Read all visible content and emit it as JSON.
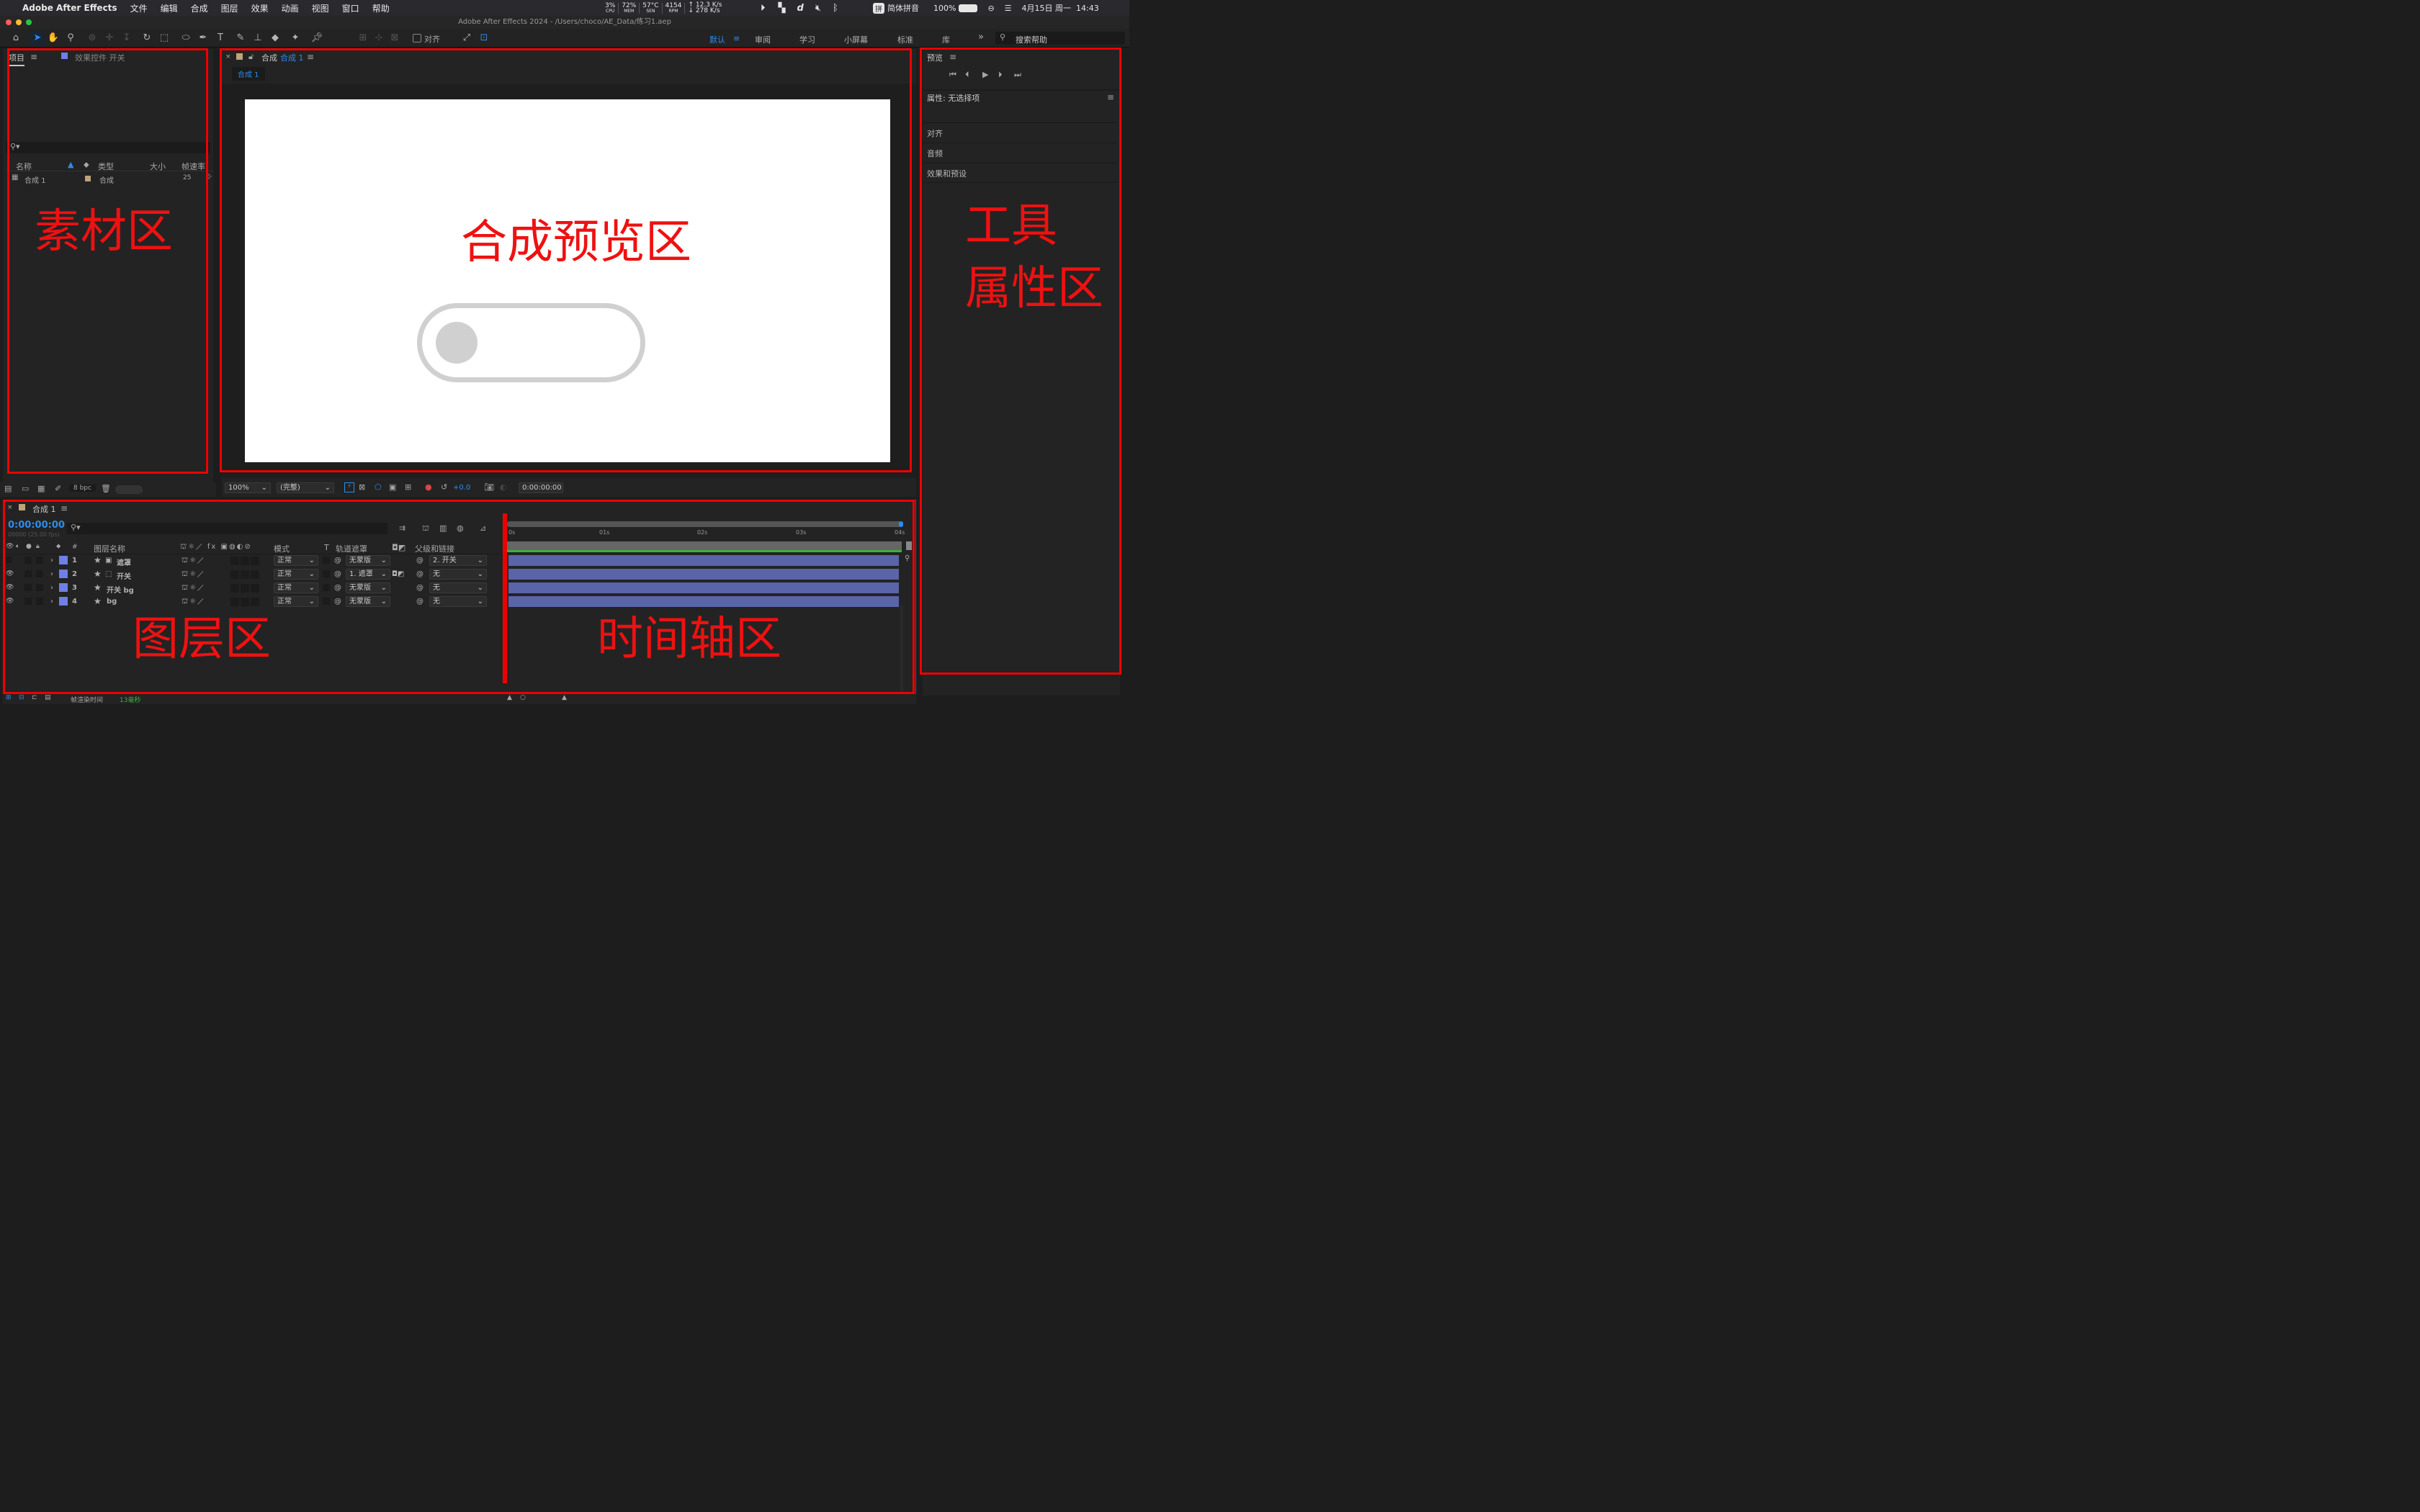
{
  "menubar": {
    "apple": "",
    "app": "Adobe After Effects",
    "items": [
      "文件",
      "编辑",
      "合成",
      "图层",
      "效果",
      "动画",
      "视图",
      "窗口",
      "帮助"
    ],
    "cpu": "3%",
    "cpu_l": "CPU",
    "mem": "72%",
    "mem_l": "MEM",
    "sen": "57°C",
    "sen_l": "SEN",
    "rpm": "4154",
    "rpm_l": "RPM",
    "up": "↑ 12.3 K/s",
    "down": "↓ 278 K/s",
    "ime": "简体拼音",
    "ime_badge": "拼",
    "battery": "100%",
    "datetime": "4月15日 周一  14:43"
  },
  "title": "Adobe After Effects 2024 - /Users/choco/AE_Data/练习1.aep",
  "toolbar": {
    "align_label": "对齐",
    "workspaces": [
      "默认",
      "审阅",
      "学习",
      "小屏幕",
      "标准",
      "库"
    ],
    "search_placeholder": "搜索帮助",
    "more": "»"
  },
  "project": {
    "tab": "项目",
    "tab2": "效果控件 开关",
    "columns": [
      "名称",
      "类型",
      "大小",
      "帧速率"
    ],
    "items": [
      {
        "name": "合成 1",
        "type": "合成",
        "rate": "25"
      }
    ],
    "bpc": "8 bpc"
  },
  "comp": {
    "tab_prefix": "合成",
    "tab_name": "合成 1",
    "subtab": "合成 1",
    "zoom": "100%",
    "quality": "(完整)",
    "exposure": "+0.0",
    "timecode": "0:00:00:00"
  },
  "timeline": {
    "tab": "合成 1",
    "timecode": "0:00:00:00",
    "fps": "00000 (25.00 fps)",
    "col_name": "图层名称",
    "col_mode": "模式",
    "col_t": "T",
    "col_track": "轨道遮罩",
    "col_parent": "父级和链接",
    "col_num": "#",
    "layers": [
      {
        "num": "1",
        "name": "遮罩",
        "mode": "正常",
        "track": "无蒙版",
        "parent": "2. 开关"
      },
      {
        "num": "2",
        "name": "开关",
        "mode": "正常",
        "track": "1. 遮罩",
        "parent": "无"
      },
      {
        "num": "3",
        "name": "开关 bg",
        "mode": "正常",
        "track": "无蒙版",
        "parent": "无"
      },
      {
        "num": "4",
        "name": "bg",
        "mode": "正常",
        "track": "无蒙版",
        "parent": "无"
      }
    ],
    "ticks": [
      "0s",
      "01s",
      "02s",
      "03s",
      "04s"
    ],
    "render_label": "帧渲染时间",
    "render_value": "13毫秒"
  },
  "right": {
    "preview": "预览",
    "properties": "属性: 无选择项",
    "sections": [
      "对齐",
      "音频",
      "效果和预设"
    ]
  },
  "annotations": {
    "footage": "素材区",
    "preview": "合成预览区",
    "tools1": "工具",
    "tools2": "属性区",
    "layers": "图层区",
    "timeline": "时间轴区"
  },
  "colors": {
    "accent": "#2d8ceb",
    "annotation": "#ee0000",
    "layer_label": "#6f7fe6",
    "layer_bar": "#5a64a8",
    "toggle": "#d0d0d0"
  }
}
